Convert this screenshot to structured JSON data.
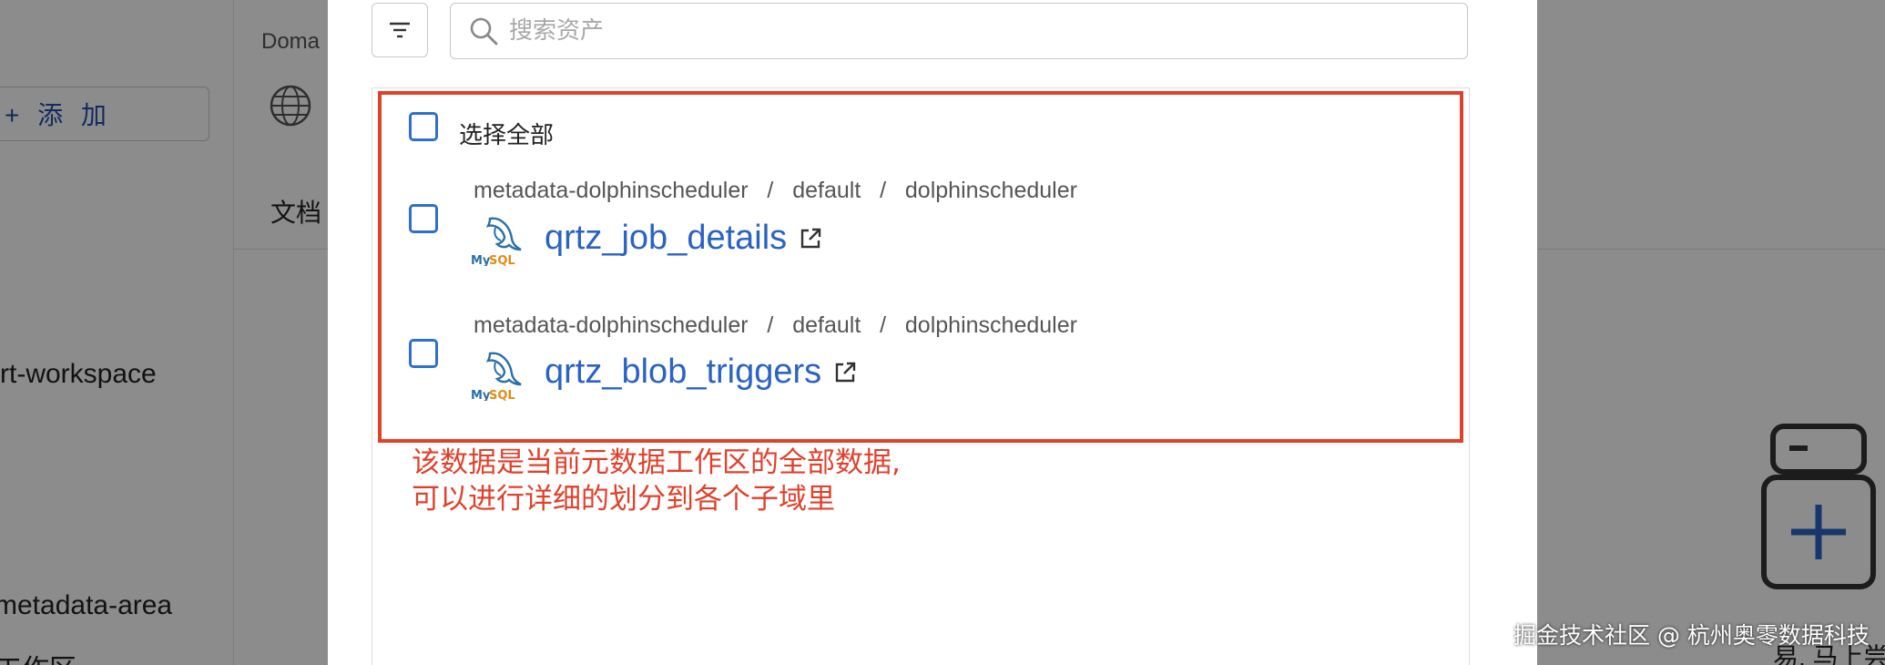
{
  "background": {
    "sidebar": {
      "add_button_label": "+ 添 加",
      "items": [
        "rt-workspace",
        "metadata-area",
        "工作区"
      ]
    },
    "main": {
      "domain_label": "Doma",
      "tab_docs": "文档",
      "empty_text": "易, 马上尝试一下!"
    }
  },
  "modal": {
    "search": {
      "placeholder": "搜索资产",
      "value": ""
    },
    "select_all_label": "选择全部",
    "assets": [
      {
        "service": "metadata-dolphinscheduler",
        "database": "default",
        "schema": "dolphinscheduler",
        "name": "qrtz_job_details",
        "icon": "mysql-icon",
        "checked": false
      },
      {
        "service": "metadata-dolphinscheduler",
        "database": "default",
        "schema": "dolphinscheduler",
        "name": "qrtz_blob_triggers",
        "icon": "mysql-icon",
        "checked": false
      }
    ]
  },
  "annotation": {
    "line1": "该数据是当前元数据工作区的全部数据,",
    "line2": "可以进行详细的划分到各个子域里"
  },
  "watermark": "掘金技术社区 @ 杭州奥零数据科技",
  "colors": {
    "accent": "#2a63c4",
    "checkbox_border": "#2f6fd1",
    "annotation_red": "#e0412b",
    "overlay": "rgba(0,0,0,0.45)"
  }
}
